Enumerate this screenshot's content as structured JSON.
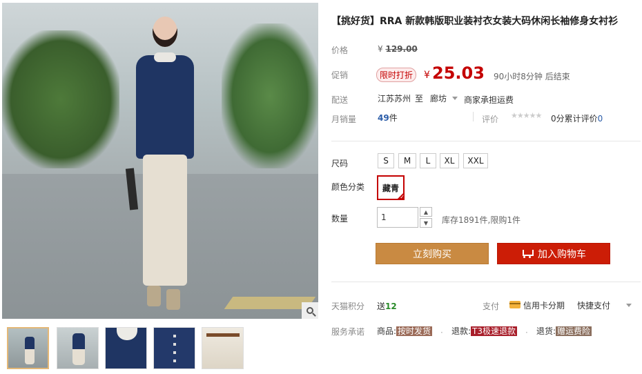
{
  "gallery": {
    "thumbnails": [
      "thumb-1",
      "thumb-2",
      "thumb-3",
      "thumb-4",
      "thumb-5"
    ]
  },
  "product": {
    "title": "【挑好货】RRA 新款韩版职业装衬衣女装大码休闲长袖修身女衬衫"
  },
  "price": {
    "label": "价格",
    "currency": "¥",
    "original": "129.00"
  },
  "promo": {
    "label": "促销",
    "tag": "限时打折",
    "currency": "¥",
    "price": "25.03",
    "countdown": "90小时8分钟 后结束"
  },
  "shipping": {
    "label": "配送",
    "from": "江苏苏州",
    "to": "至",
    "dest": "廊坊",
    "fee": "商家承担运费"
  },
  "sales": {
    "label": "月销量",
    "count": "49",
    "unit": "件",
    "review_label": "评价",
    "stars": "★★★★★",
    "score": "0分",
    "review_text": "累计评价",
    "review_count": "0"
  },
  "options": {
    "size_label": "尺码",
    "sizes": [
      "S",
      "M",
      "L",
      "XL",
      "XXL"
    ],
    "color_label": "颜色分类",
    "color": "藏青",
    "qty_label": "数量",
    "qty_value": "1",
    "stock": "库存1891件,限购1件"
  },
  "actions": {
    "buy": "立刻购买",
    "cart": "加入购物车"
  },
  "points": {
    "label": "天猫积分",
    "prefix": "送",
    "value": "12",
    "pay_label": "支付",
    "pay_card": "信用卡分期",
    "pay_fast": "快捷支付"
  },
  "promise": {
    "label": "服务承诺",
    "goods_prefix": "商品:",
    "goods_tag": "按时发货",
    "refund_prefix": "退款:",
    "refund_tag": "T3极速退款",
    "return_prefix": "退货:",
    "return_tag": "赠运费险"
  },
  "colors": {
    "promo_red": "#c40000",
    "buy_btn": "#c98a42",
    "cart_btn": "#cc1d06",
    "link_blue": "#2a5ca8"
  }
}
